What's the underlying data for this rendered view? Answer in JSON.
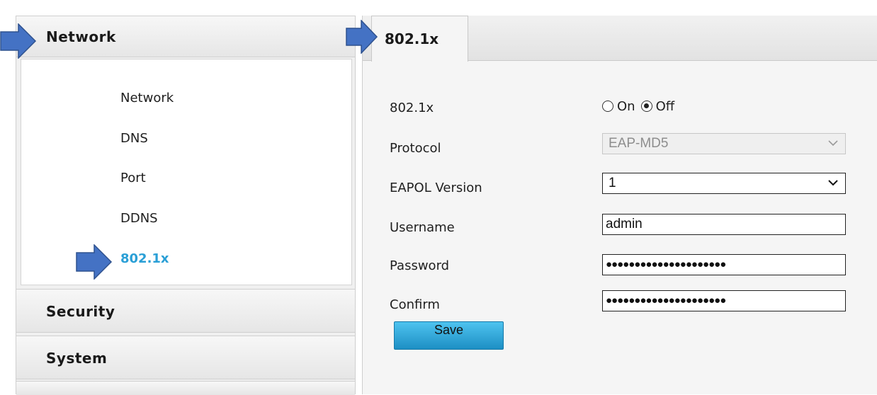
{
  "sidebar": {
    "sections": [
      {
        "label": "Network",
        "expanded": true
      },
      {
        "label": "Security",
        "expanded": false
      },
      {
        "label": "System",
        "expanded": false
      }
    ],
    "network_items": [
      {
        "label": "Network",
        "active": false
      },
      {
        "label": "DNS",
        "active": false
      },
      {
        "label": "Port",
        "active": false
      },
      {
        "label": "DDNS",
        "active": false
      },
      {
        "label": "802.1x",
        "active": true
      }
    ]
  },
  "tab": {
    "label": "802.1x"
  },
  "form": {
    "enable": {
      "label": "802.1x",
      "on_label": "On",
      "off_label": "Off",
      "selected": "Off"
    },
    "protocol": {
      "label": "Protocol",
      "value": "EAP-MD5",
      "disabled": true
    },
    "eapol_version": {
      "label": "EAPOL Version",
      "value": "1"
    },
    "username": {
      "label": "Username",
      "value": "admin"
    },
    "password": {
      "label": "Password",
      "value": "●●●●●●●●●●●●●●●●●●●●●"
    },
    "confirm": {
      "label": "Confirm",
      "value": "●●●●●●●●●●●●●●●●●●●●●"
    },
    "save_label": "Save"
  },
  "colors": {
    "active_item": "#2a9fd6",
    "save_button": "#2aa5db",
    "annotation_arrow": "#4472c4"
  },
  "icons": {
    "dropdown": "chevron-down-icon",
    "annotation": "right-arrow-icon"
  }
}
